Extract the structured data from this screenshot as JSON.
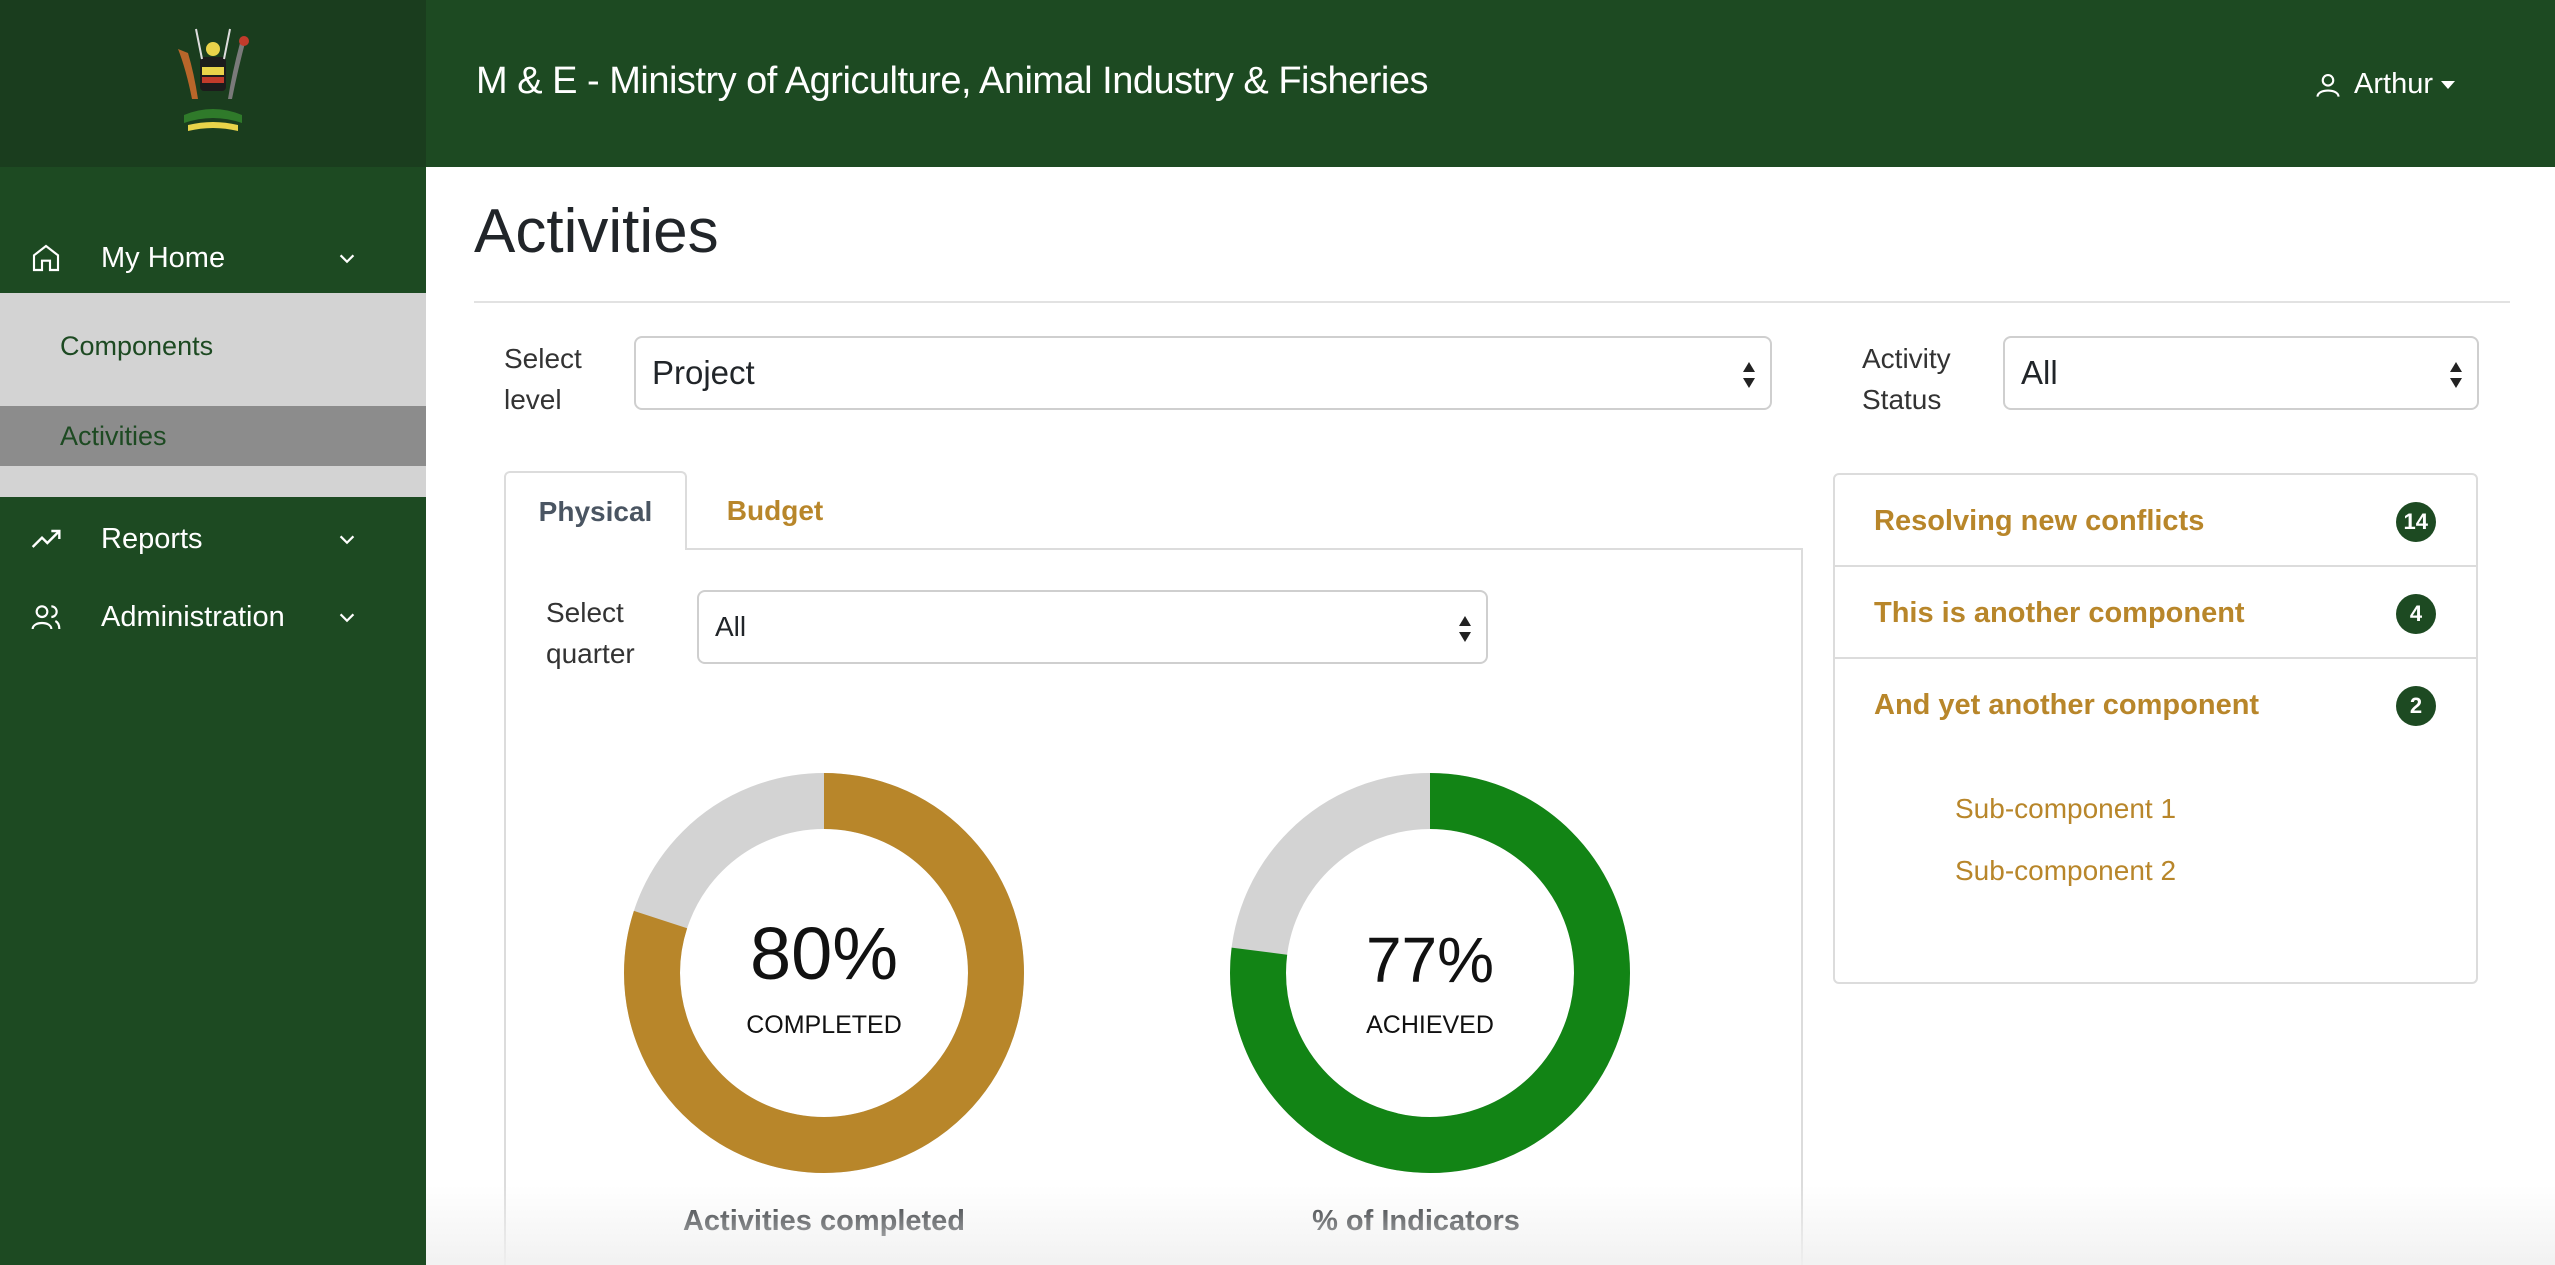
{
  "header": {
    "title": "M & E - Ministry of Agriculture, Animal Industry & Fisheries",
    "user_name": "Arthur"
  },
  "sidebar": {
    "items": [
      {
        "label": "My Home",
        "icon": "home-icon",
        "expanded": true
      },
      {
        "label": "Reports",
        "icon": "trending-up-icon",
        "expanded": false
      },
      {
        "label": "Administration",
        "icon": "users-icon",
        "expanded": false
      }
    ],
    "subitems": [
      {
        "label": "Components",
        "active": false
      },
      {
        "label": "Activities",
        "active": true
      }
    ]
  },
  "page": {
    "title": "Activities"
  },
  "filters": {
    "level_label": "Select level",
    "level_label_line1": "Select",
    "level_label_line2": "level",
    "level_value": "Project",
    "status_label_line1": "Activity",
    "status_label_line2": "Status",
    "status_value": "All"
  },
  "tabs": [
    {
      "label": "Physical",
      "active": true
    },
    {
      "label": "Budget",
      "active": false
    }
  ],
  "quarter": {
    "label_line1": "Select",
    "label_line2": "quarter",
    "value": "All"
  },
  "chart_data": [
    {
      "type": "pie",
      "title": "Activities completed",
      "center_value": "80%",
      "center_label": "COMPLETED",
      "values": [
        80,
        20
      ],
      "colors": [
        "#b8862a",
        "#d3d3d3"
      ]
    },
    {
      "type": "pie",
      "title": "% of Indicators",
      "center_value": "77%",
      "center_label": "ACHIEVED",
      "values": [
        77,
        23
      ],
      "colors": [
        "#128415",
        "#d3d3d3"
      ]
    }
  ],
  "components": [
    {
      "label": "Resolving new conflicts",
      "count": "14"
    },
    {
      "label": "This is another component",
      "count": "4"
    },
    {
      "label": "And yet another component",
      "count": "2"
    }
  ],
  "subcomponents": [
    {
      "label": "Sub-component 1"
    },
    {
      "label": "Sub-component 2"
    }
  ],
  "colors": {
    "primary_green": "#1d4a22",
    "accent_gold": "#b8862a",
    "achieved_green": "#128415",
    "track_gray": "#d3d3d3"
  }
}
